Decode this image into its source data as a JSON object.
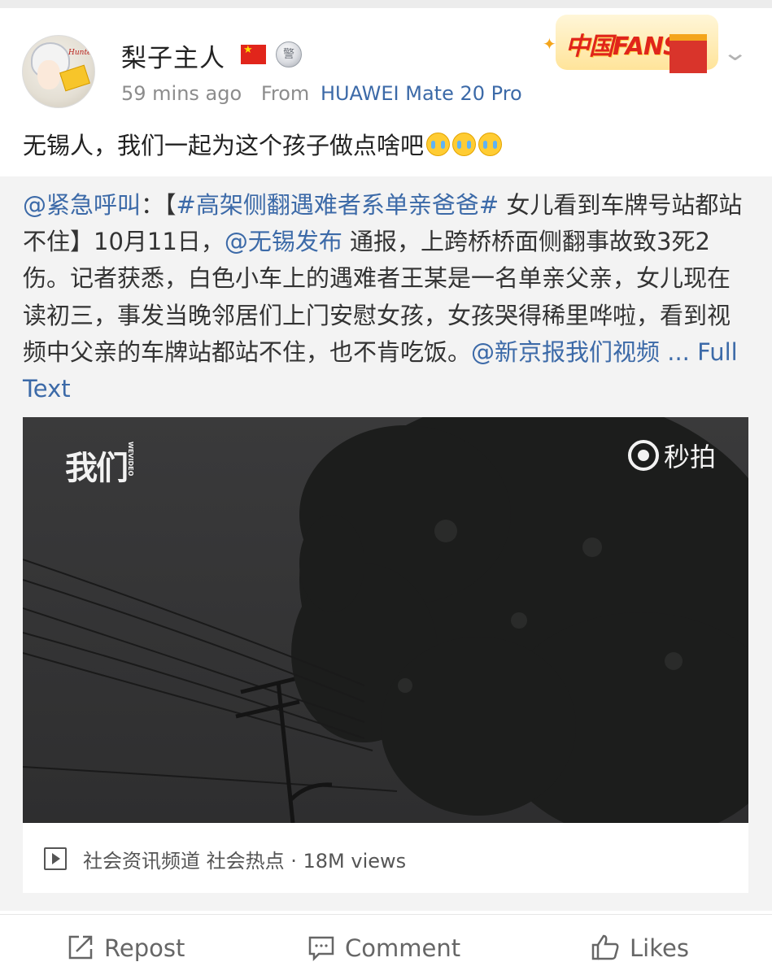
{
  "post": {
    "username": "梨子主人",
    "time": "59 mins ago",
    "from_label": "From",
    "device": "HUAWEI Mate 20 Pro",
    "badge_text": "中国FANS",
    "text": "无锡人，我们一起为这个孩子做点啥吧",
    "emoji": "cry-emoji"
  },
  "repost": {
    "mention": "@紧急呼叫",
    "colon": "：【",
    "hashtag": "#高架侧翻遇难者系单亲爸爸#",
    "body_1": " 女儿看到车牌号站都站不住】10月11日，",
    "mention2": "@无锡发布",
    "body_2": " 通报，上跨桥桥面侧翻事故致3死2伤。记者获悉，白色小车上的遇难者王某是一名单亲父亲，女儿现在读初三，事发当晚邻居们上门安慰女孩，女孩哭得稀里哗啦，看到视频中父亲的车牌站都站不住，也不肯吃饭。",
    "mention3": "@新京报我们视频",
    "more": " ... Full Text"
  },
  "video": {
    "logo_left": "我们",
    "logo_left_small": "WEVIDEO",
    "logo_right": "秒拍",
    "meta": "社会资讯频道 社会热点 · 18M views"
  },
  "actions": {
    "repost": "Repost",
    "comment": "Comment",
    "likes": "Likes"
  }
}
